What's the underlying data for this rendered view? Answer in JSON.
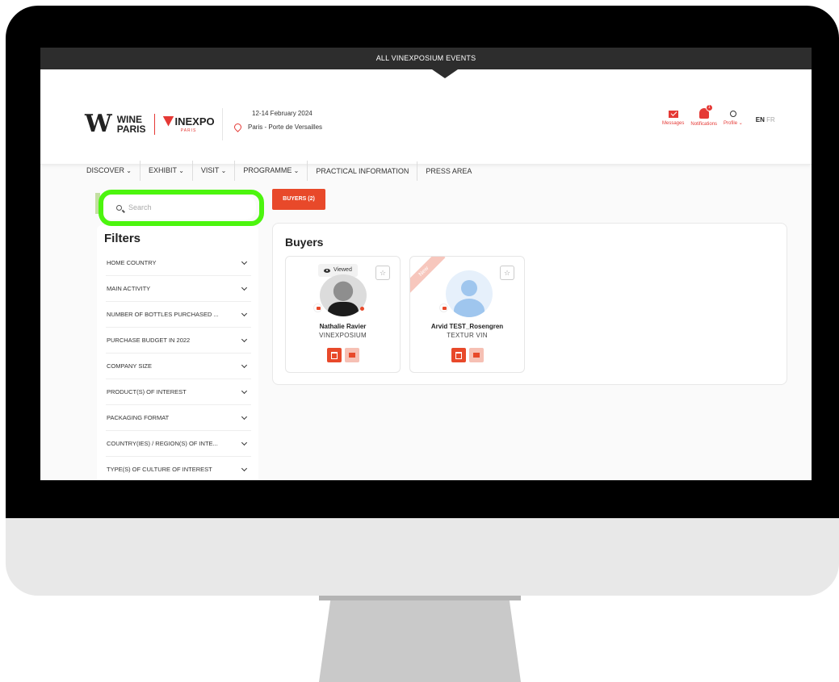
{
  "top_bar": {
    "label": "ALL VINEXPOSIUM EVENTS"
  },
  "header": {
    "logo_wine_line1": "WINE",
    "logo_wine_line2": "PARIS",
    "logo_vinexpo": "INEXPO",
    "logo_vinexpo_sub": "PARIS",
    "event_date": "12-14 February 2024",
    "event_place": "Paris - Porte de Versailles",
    "messages_label": "Messages",
    "notifications_label": "Notifications",
    "notifications_count": "1",
    "profile_label": "Profile",
    "lang_en": "EN",
    "lang_fr": "FR"
  },
  "nav": {
    "items": [
      {
        "label": "DISCOVER"
      },
      {
        "label": "EXHIBIT"
      },
      {
        "label": "VISIT"
      },
      {
        "label": "PROGRAMME"
      },
      {
        "label": "PRACTICAL INFORMATION"
      },
      {
        "label": "PRESS AREA"
      }
    ]
  },
  "search": {
    "placeholder": "Search"
  },
  "filters": {
    "title": "Filters",
    "items": [
      "HOME COUNTRY",
      "MAIN ACTIVITY",
      "NUMBER OF BOTTLES PURCHASED ...",
      "PURCHASE BUDGET IN 2022",
      "COMPANY SIZE",
      "PRODUCT(S) OF INTEREST",
      "PACKAGING FORMAT",
      "COUNTRY(IES) / REGION(S) OF INTE...",
      "TYPE(S) OF CULTURE OF INTEREST"
    ]
  },
  "buyers_tab": {
    "label": "BUYERS (2)"
  },
  "buyers": {
    "title": "Buyers",
    "cards": [
      {
        "name": "Nathalie Ravier",
        "company": "VINEXPOSIUM",
        "badge": "Viewed",
        "star": "☆"
      },
      {
        "name": "Arvid TEST_Rosengren",
        "company": "TEXTUR VIN",
        "ribbon": "New",
        "star": "☆"
      }
    ]
  },
  "colors": {
    "accent": "#e8492a",
    "highlight": "#4cf50e",
    "topbar": "#2d2d2d"
  }
}
